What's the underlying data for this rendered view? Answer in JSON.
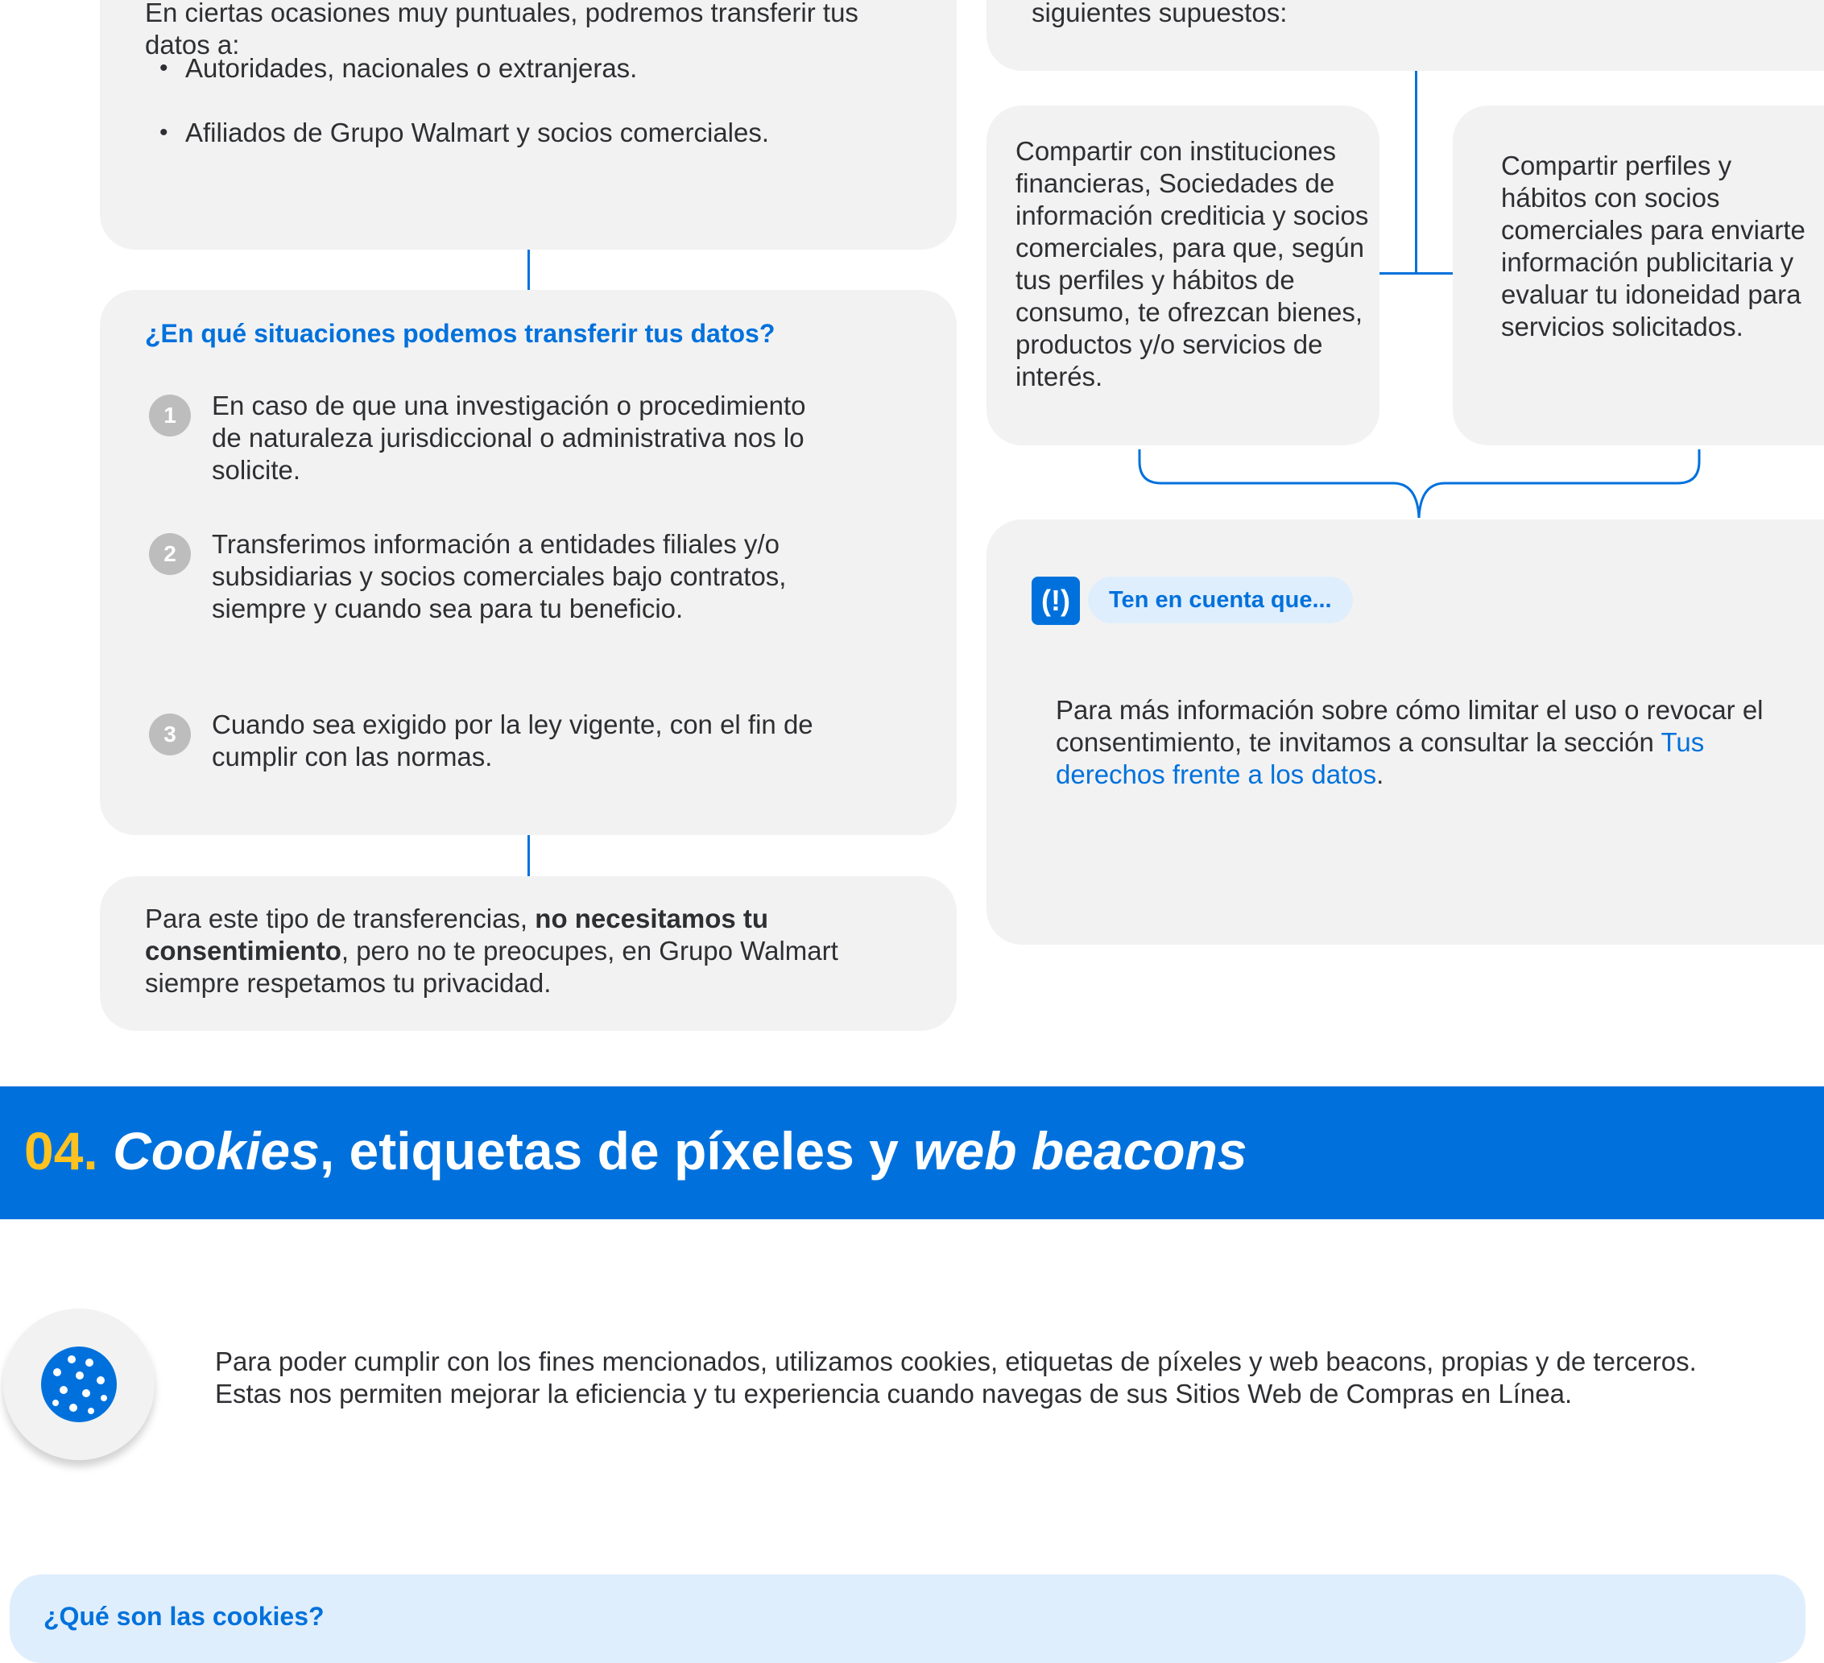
{
  "transfers": {
    "intro_text": "En ciertas ocasiones muy puntuales, podremos transferir tus datos a:",
    "recipients": [
      "Autoridades, nacionales o extranjeras.",
      "Afiliados de Grupo Walmart y socios comerciales."
    ],
    "situations_title": "¿En qué situaciones podemos transferir tus datos?",
    "situations": [
      {
        "num": "1",
        "text": "En caso de que una investigación o procedimiento de naturaleza jurisdiccional o administrativa nos lo solicite."
      },
      {
        "num": "2",
        "text": "Transferimos información a entidades filiales y/o subsidiarias y socios comerciales bajo contratos, siempre y cuando sea para tu beneficio."
      },
      {
        "num": "3",
        "text": "Cuando sea exigido por la ley vigente, con el fin de cumplir con las normas."
      }
    ],
    "consent_prefix": "Para este tipo de transferencias, ",
    "consent_bold": "no necesitamos tu consentimiento",
    "consent_suffix": ", pero no te preocupes, en Grupo Walmart siempre respetamos tu privacidad."
  },
  "consent_cases": {
    "header_text": "siguientes supuestos:",
    "case_financial": "Compartir con instituciones financieras, Sociedades de información crediticia y socios comerciales, para que, según tus perfiles y hábitos de consumo, te ofrezcan bienes, productos y/o servicios de interés.",
    "case_profiles": "Compartir perfiles y hábitos con socios comerciales para enviarte información publicitaria y evaluar tu idoneidad para servicios solicitados.",
    "note_icon": "exclamation-icon",
    "note_label": "Ten en cuenta que...",
    "note_text": "Para más información sobre cómo limitar el uso o revocar el consentimiento, te invitamos a consultar la sección ",
    "note_link": "Tus derechos frente a los datos",
    "note_end": "."
  },
  "section": {
    "number": "04.",
    "title_italic_1": "Cookies",
    "title_middle": ", etiquetas de píxeles y ",
    "title_italic_2": "web beacons",
    "cookie_icon": "cookie-icon",
    "description": "Para poder cumplir con los fines mencionados, utilizamos cookies, etiquetas de píxeles y web beacons, propias y de terceros. Estas nos permiten mejorar la eficiencia y tu experiencia cuando navegas de sus Sitios Web de Compras en Línea.",
    "faq_title": "¿Qué son las cookies?"
  },
  "colors": {
    "brand_blue": "#0071dc",
    "accent_yellow": "#ffc220",
    "card_gray": "#f2f2f2",
    "light_blue": "#dfeefc"
  }
}
